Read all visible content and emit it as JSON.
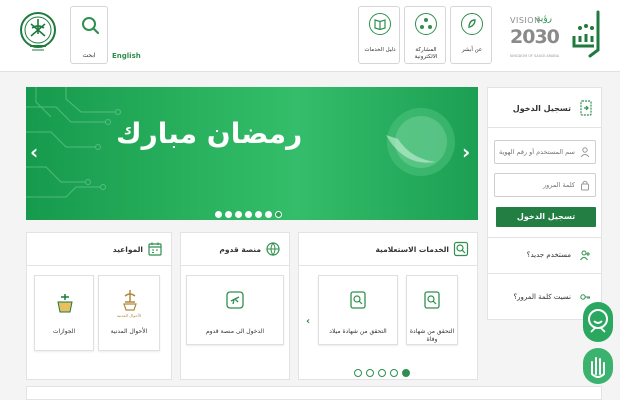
{
  "header": {
    "search_label": "ابحث",
    "language_link": "English",
    "nav": [
      {
        "label": "دليل الخدمات",
        "icon": "book-icon"
      },
      {
        "label": "المشاركة الالكترونية",
        "icon": "participation-icon"
      },
      {
        "label": "عن أبشر",
        "icon": "about-icon"
      }
    ],
    "vision": {
      "line1": "VISION",
      "arabic": "رؤية",
      "year": "2030",
      "kingdom": "KINGDOM OF SAUDI ARABIA"
    }
  },
  "banner": {
    "greeting": "رمضان مبارك",
    "slide_count": 7,
    "active_slide": 6
  },
  "login": {
    "title": "تسجيل الدخول",
    "username_placeholder": "اسم المستخدم أو رقم الهوية",
    "password_placeholder": "كلمة المرور",
    "submit_label": "تسجيل الدخول",
    "new_user": "مستخدم جديد؟",
    "forgot_password": "نسيت كلمة المرور؟"
  },
  "services": {
    "title": "الخدمات الاستعلامية",
    "tiles": [
      {
        "label": "التحقق من شهادة وفاة"
      },
      {
        "label": "التحقق من شهادة ميلاد"
      }
    ],
    "page_count": 5,
    "active_page": 4
  },
  "arrival": {
    "title": "منصة قدوم",
    "tiles": [
      {
        "label": "الدخول الى منصة قدوم"
      }
    ]
  },
  "appointments": {
    "title": "المواعيد",
    "tiles": [
      {
        "label": "الأحوال المدنية",
        "logo_text": "الأحوال المدنية"
      },
      {
        "label": "الجوازات"
      }
    ]
  },
  "colors": {
    "brand_green": "#237e43",
    "banner_green": "#2db661"
  }
}
